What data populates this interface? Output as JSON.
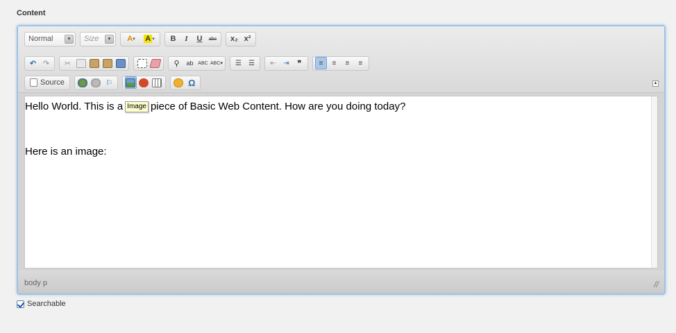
{
  "field": {
    "label": "Content"
  },
  "toolbar": {
    "format_combo": "Normal",
    "size_combo": "Size",
    "bold": "B",
    "italic": "I",
    "underline": "U",
    "strike": "abc",
    "subscript": "x₂",
    "superscript": "x²",
    "source": "Source",
    "icons": {
      "text_color": "text-color-icon",
      "bg_color": "bg-color-icon",
      "undo": "undo-icon",
      "redo": "redo-icon",
      "cut": "cut-icon",
      "copy": "copy-icon",
      "paste": "paste-icon",
      "paste_text": "paste-text-icon",
      "paste_word": "paste-word-icon",
      "select_all": "select-all-icon",
      "remove_format": "remove-format-icon",
      "find": "find-icon",
      "replace": "replace-icon",
      "spellcheck": "spellcheck-icon",
      "scayt": "scayt-icon",
      "numbered_list": "numbered-list-icon",
      "bulleted_list": "bulleted-list-icon",
      "outdent": "outdent-icon",
      "indent": "indent-icon",
      "blockquote": "blockquote-icon",
      "align_left": "align-left-icon",
      "align_center": "align-center-icon",
      "align_right": "align-right-icon",
      "justify": "justify-icon",
      "link": "link-icon",
      "unlink": "unlink-icon",
      "anchor": "anchor-icon",
      "image": "image-icon",
      "flash": "flash-icon",
      "table": "table-icon",
      "smiley": "smiley-icon",
      "special_char": "Ω"
    }
  },
  "content": {
    "before_tooltip": "Hello World. This is a",
    "tooltip": "Image",
    "after_tooltip": "piece of Basic Web Content. How are you doing today?",
    "line2": "Here is an image:"
  },
  "statusbar": {
    "path": "body  p"
  },
  "checkbox": {
    "label": "Searchable",
    "checked": true
  },
  "colors": {
    "frame_border": "#9ec3e6",
    "active_button": "#a9c8e8",
    "tooltip_bg": "#ffffcc"
  }
}
